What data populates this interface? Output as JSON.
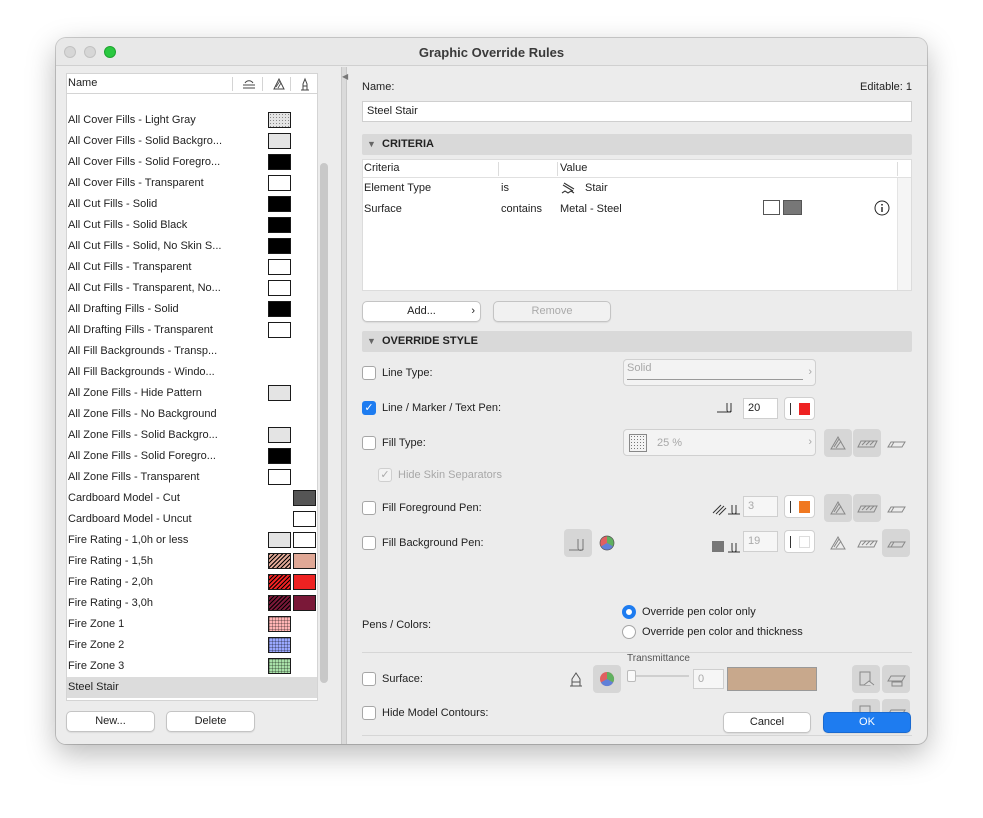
{
  "window": {
    "title": "Graphic Override Rules"
  },
  "left_panel": {
    "header": {
      "name_label": "Name"
    },
    "rules": [
      {
        "label": "All Cover Fills - Light Gray",
        "sw1": "#e4e4e4",
        "sw1_pattern": "dots"
      },
      {
        "label": "All Cover Fills - Solid Backgro...",
        "sw1": "#e4e4e4"
      },
      {
        "label": "All Cover Fills - Solid Foregro...",
        "sw1": "#000000"
      },
      {
        "label": "All Cover Fills - Transparent",
        "sw1": "#ffffff"
      },
      {
        "label": "All Cut Fills - Solid",
        "sw1": "#000000"
      },
      {
        "label": "All Cut Fills - Solid Black",
        "sw1": "#000000"
      },
      {
        "label": "All Cut Fills - Solid, No Skin S...",
        "sw1": "#000000"
      },
      {
        "label": "All Cut Fills - Transparent",
        "sw1": "#ffffff"
      },
      {
        "label": "All Cut Fills - Transparent, No...",
        "sw1": "#ffffff"
      },
      {
        "label": "All Drafting Fills - Solid",
        "sw1": "#000000"
      },
      {
        "label": "All Drafting Fills - Transparent",
        "sw1": "#ffffff"
      },
      {
        "label": "All Fill Backgrounds - Transp..."
      },
      {
        "label": "All Fill Backgrounds - Windo..."
      },
      {
        "label": "All Zone Fills - Hide Pattern",
        "sw1": "#e4e4e4"
      },
      {
        "label": "All Zone Fills - No Background"
      },
      {
        "label": "All Zone Fills - Solid Backgro...",
        "sw1": "#e4e4e4"
      },
      {
        "label": "All Zone Fills - Solid Foregro...",
        "sw1": "#000000"
      },
      {
        "label": "All Zone Fills - Transparent",
        "sw1": "#ffffff"
      },
      {
        "label": "Cardboard Model - Cut",
        "sw2": "#555555"
      },
      {
        "label": "Cardboard Model - Uncut",
        "sw2": "#ffffff"
      },
      {
        "label": "Fire Rating - 1,0h or less",
        "sw1": "#e4e4e4",
        "sw2": "#ffffff"
      },
      {
        "label": "Fire Rating - 1,5h",
        "sw1": "#e0a896",
        "sw1_pattern": "hatch",
        "sw2": "#e0a896"
      },
      {
        "label": "Fire Rating - 2,0h",
        "sw1": "#ee2222",
        "sw1_pattern": "hatch",
        "sw2": "#ee2222"
      },
      {
        "label": "Fire Rating - 3,0h",
        "sw1": "#7a1838",
        "sw1_pattern": "hatch",
        "sw2": "#7a1838"
      },
      {
        "label": "Fire Zone 1",
        "sw1": "#ffb4b4",
        "sw1_pattern": "grid"
      },
      {
        "label": "Fire Zone 2",
        "sw1": "#9aa8ff",
        "sw1_pattern": "grid"
      },
      {
        "label": "Fire Zone 3",
        "sw1": "#a8e0a8",
        "sw1_pattern": "grid"
      },
      {
        "label": "Steel Stair",
        "selected": true
      }
    ],
    "new_button": "New...",
    "delete_button": "Delete"
  },
  "right_panel": {
    "name_label": "Name:",
    "editable_label": "Editable: 1",
    "name_value": "Steel Stair",
    "criteria_section": "CRITERIA",
    "criteria_table": {
      "col_criteria": "Criteria",
      "col_value": "Value",
      "rows": [
        {
          "criteria": "Element Type",
          "operator": "is",
          "value": "Stair"
        },
        {
          "criteria": "Surface",
          "operator": "contains",
          "value": "Metal - Steel"
        }
      ]
    },
    "add_button": "Add...",
    "remove_button": "Remove",
    "override_section": "OVERRIDE STYLE",
    "line_type": {
      "label": "Line Type:",
      "checked": false,
      "value": "Solid"
    },
    "line_pen": {
      "label": "Line / Marker / Text Pen:",
      "checked": true,
      "pen_number": "20",
      "color": "#ee2222"
    },
    "fill_type": {
      "label": "Fill Type:",
      "checked": false,
      "value": "25 %"
    },
    "hide_skin": {
      "label": "Hide Skin Separators",
      "checked": true
    },
    "fill_fg_pen": {
      "label": "Fill Foreground Pen:",
      "checked": false,
      "pen_number": "3",
      "color": "#f07820"
    },
    "fill_bg_pen": {
      "label": "Fill Background Pen:",
      "checked": false,
      "pen_number": "19",
      "color": "#ffffff"
    },
    "pens_colors": {
      "label": "Pens / Colors:",
      "option_1": "Override pen color only",
      "option_2": "Override pen color and thickness",
      "selected": "option_1"
    },
    "surface": {
      "label": "Surface:",
      "checked": false,
      "transmittance_label": "Transmittance",
      "transmittance_value": "0",
      "color": "#c8a88c"
    },
    "hide_contours": {
      "label": "Hide Model Contours:",
      "checked": false
    },
    "cancel_button": "Cancel",
    "ok_button": "OK"
  },
  "colors": {
    "accent": "#1e7cf0",
    "selection": "#dcdcdc"
  }
}
